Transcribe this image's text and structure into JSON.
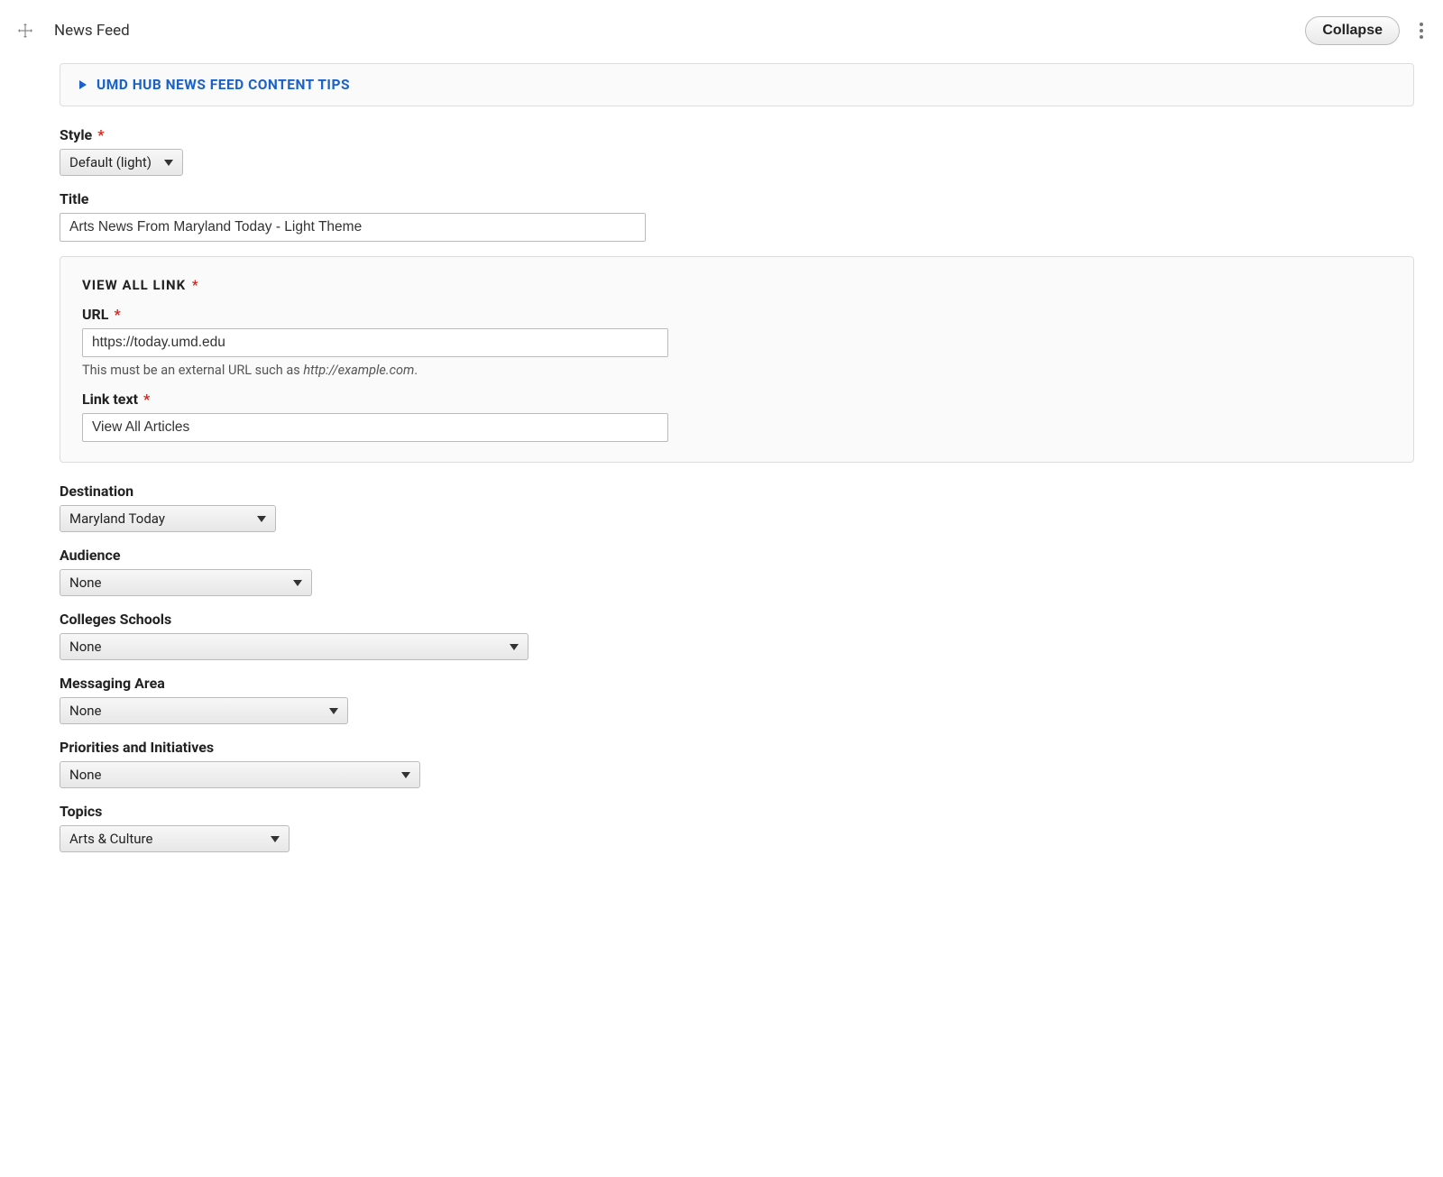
{
  "header": {
    "title": "News Feed",
    "collapse_label": "Collapse"
  },
  "tips": {
    "label": "UMD HUB NEWS FEED CONTENT TIPS"
  },
  "style": {
    "label": "Style",
    "required": "*",
    "value": "Default (light)"
  },
  "title_field": {
    "label": "Title",
    "value": "Arts News From Maryland Today - Light Theme"
  },
  "view_all": {
    "legend": "VIEW ALL LINK",
    "required": "*",
    "url": {
      "label": "URL",
      "required": "*",
      "value": "https://today.umd.edu",
      "help_prefix": "This must be an external URL such as ",
      "help_example": "http://example.com",
      "help_suffix": "."
    },
    "link_text": {
      "label": "Link text",
      "required": "*",
      "value": "View All Articles"
    }
  },
  "destination": {
    "label": "Destination",
    "value": "Maryland Today"
  },
  "audience": {
    "label": "Audience",
    "value": "None"
  },
  "colleges": {
    "label": "Colleges Schools",
    "value": "None"
  },
  "messaging": {
    "label": "Messaging Area",
    "value": "None"
  },
  "priorities": {
    "label": "Priorities and Initiatives",
    "value": "None"
  },
  "topics": {
    "label": "Topics",
    "value": "Arts & Culture"
  }
}
